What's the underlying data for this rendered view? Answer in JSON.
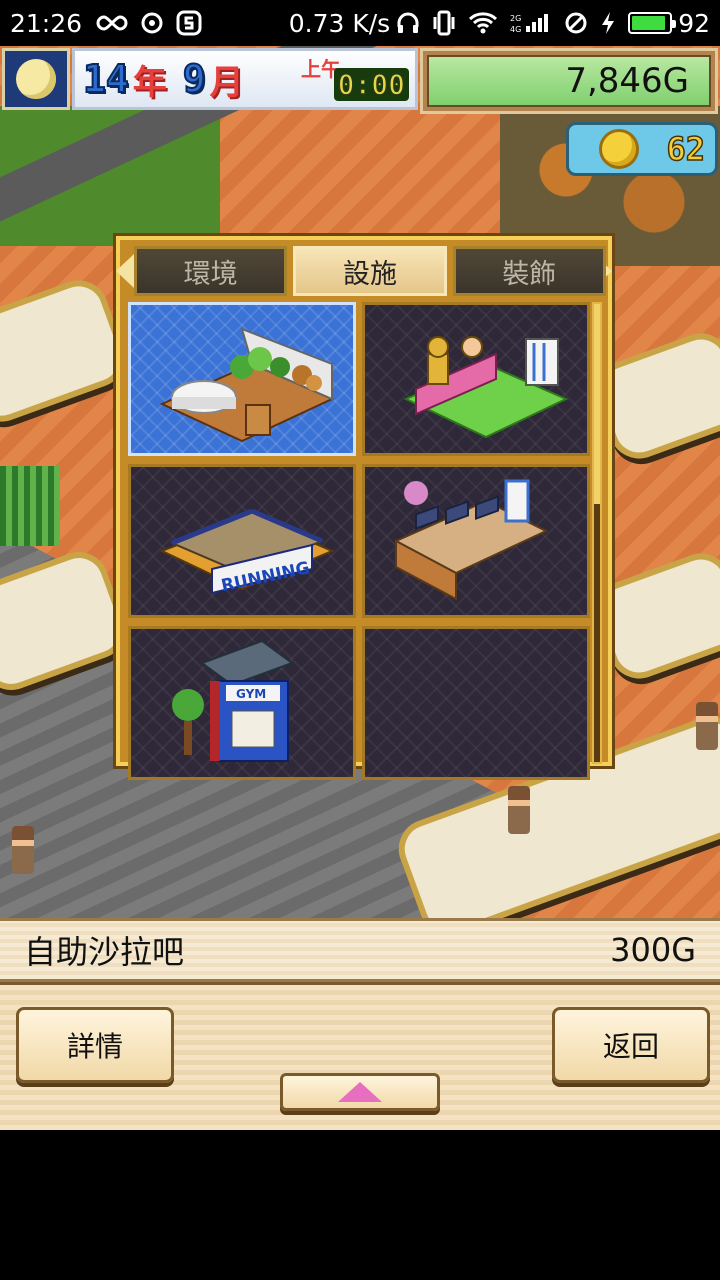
{
  "status_bar": {
    "time": "21:26",
    "speed": "0.73 K/s",
    "battery": "92",
    "battery_level": 0.92
  },
  "hud": {
    "year_num": "14",
    "year_unit": "年",
    "month_num": "9",
    "month_unit": "月",
    "ampm": "上午",
    "clock": "0:00",
    "money": "7,846G",
    "coins": "62"
  },
  "panel": {
    "tabs": [
      {
        "label": "環境",
        "active": false
      },
      {
        "label": "設施",
        "active": true
      },
      {
        "label": "裝飾",
        "active": false
      }
    ],
    "items": [
      {
        "name": "salad-bar",
        "icon": "salad-bar-icon",
        "selected": true
      },
      {
        "name": "trophy-stand",
        "icon": "trophy-stand-icon",
        "selected": false
      },
      {
        "name": "running-machine",
        "icon": "running-machine-icon",
        "selected": false
      },
      {
        "name": "market-stall",
        "icon": "market-stall-icon",
        "selected": false
      },
      {
        "name": "gym-booth",
        "icon": "gym-booth-icon",
        "label": "GYM",
        "selected": false
      },
      {
        "name": "empty",
        "icon": "",
        "selected": false
      }
    ],
    "running_label": "RUNNING",
    "gym_label": "GYM"
  },
  "info": {
    "item_name": "自助沙拉吧",
    "price": "300G"
  },
  "buttons": {
    "detail": "詳情",
    "back": "返回"
  }
}
